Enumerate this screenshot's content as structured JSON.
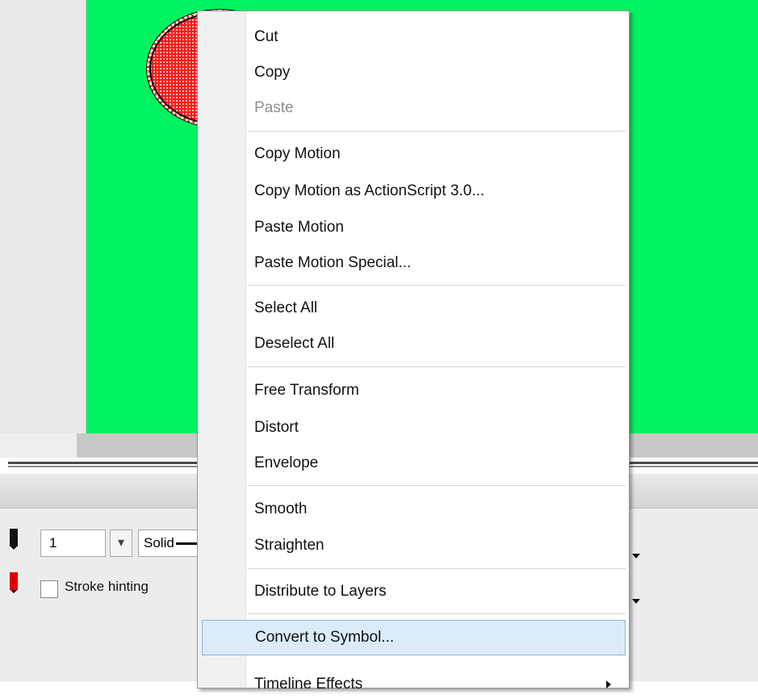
{
  "stage": {
    "background": "#00f260",
    "shape_fill": "#ff1a1a"
  },
  "properties": {
    "stroke_width": "1",
    "stroke_style": "Solid",
    "stroke_hinting_label": "Stroke hinting",
    "spin_glyph": "▾"
  },
  "context_menu": {
    "items": [
      {
        "label": "Cut",
        "enabled": true
      },
      {
        "label": "Copy",
        "enabled": true
      },
      {
        "label": "Paste",
        "enabled": false
      },
      {
        "label": "Copy Motion",
        "enabled": true
      },
      {
        "label": "Copy Motion as ActionScript 3.0...",
        "enabled": true
      },
      {
        "label": "Paste Motion",
        "enabled": true
      },
      {
        "label": "Paste Motion Special...",
        "enabled": true
      },
      {
        "label": "Select All",
        "enabled": true
      },
      {
        "label": "Deselect All",
        "enabled": true
      },
      {
        "label": "Free Transform",
        "enabled": true
      },
      {
        "label": "Distort",
        "enabled": true
      },
      {
        "label": "Envelope",
        "enabled": true
      },
      {
        "label": "Smooth",
        "enabled": true
      },
      {
        "label": "Straighten",
        "enabled": true
      },
      {
        "label": "Distribute to Layers",
        "enabled": true
      },
      {
        "label": "Convert to Symbol...",
        "enabled": true,
        "highlighted": true
      },
      {
        "label": "Timeline Effects",
        "enabled": true,
        "submenu": true
      }
    ]
  }
}
